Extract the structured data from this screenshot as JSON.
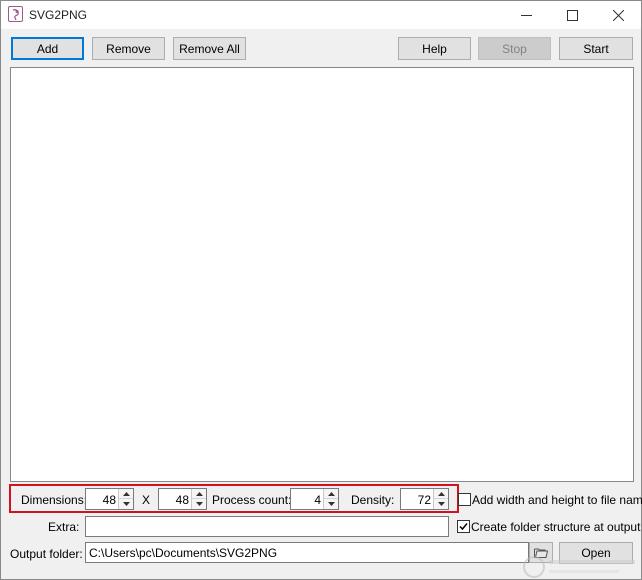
{
  "window": {
    "title": "SVG2PNG",
    "minimize_icon": "minimize-icon",
    "maximize_icon": "maximize-icon",
    "close_icon": "close-icon"
  },
  "toolbar": {
    "add_label": "Add",
    "remove_label": "Remove",
    "remove_all_label": "Remove All",
    "help_label": "Help",
    "stop_label": "Stop",
    "start_label": "Start"
  },
  "file_list": {
    "items": []
  },
  "options": {
    "dimensions_label": "Dimensions:",
    "width_value": "48",
    "x_label": "X",
    "height_value": "48",
    "process_count_label": "Process count:",
    "process_count_value": "4",
    "density_label": "Density:",
    "density_value": "72",
    "add_wh_label": "Add width and height to file name",
    "add_wh_checked": false,
    "extra_label": "Extra:",
    "extra_value": "",
    "create_folder_label": "Create folder structure at output",
    "create_folder_checked": true,
    "output_folder_label": "Output folder:",
    "output_folder_value": "C:\\Users\\pc\\Documents\\SVG2PNG",
    "open_label": "Open",
    "browse_icon": "folder-icon"
  },
  "colors": {
    "highlight": "#d4111f",
    "focus_border": "#0078d7"
  }
}
